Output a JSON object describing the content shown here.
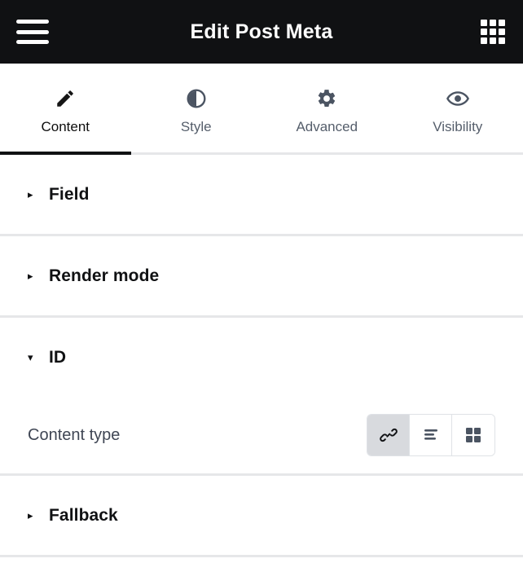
{
  "topbar": {
    "title": "Edit Post Meta",
    "menu_icon": "hamburger-menu-icon",
    "apps_icon": "grid-apps-icon"
  },
  "tabs": [
    {
      "label": "Content",
      "icon": "pencil-icon",
      "active": true
    },
    {
      "label": "Style",
      "icon": "contrast-icon",
      "active": false
    },
    {
      "label": "Advanced",
      "icon": "gear-icon",
      "active": false
    },
    {
      "label": "Visibility",
      "icon": "eye-icon",
      "active": false
    }
  ],
  "sections": [
    {
      "title": "Field",
      "expanded": false,
      "caret": "▸"
    },
    {
      "title": "Render mode",
      "expanded": false,
      "caret": "▸"
    },
    {
      "title": "ID",
      "expanded": true,
      "caret": "▾"
    },
    {
      "title": "Fallback",
      "expanded": false,
      "caret": "▸"
    }
  ],
  "id_section": {
    "content_type": {
      "label": "Content type",
      "options": [
        {
          "name": "link-icon",
          "selected": true
        },
        {
          "name": "text-lines-icon",
          "selected": false
        },
        {
          "name": "grid-squares-icon",
          "selected": false
        }
      ]
    }
  },
  "colors": {
    "topbar_bg": "#101113",
    "active_tab": "#0e0e0e",
    "inactive_tab": "#555e6b",
    "divider": "#e6e7e9",
    "label_text": "#3f4654",
    "segment_selected_bg": "#d8dade",
    "icon_slate": "#4b5462"
  }
}
